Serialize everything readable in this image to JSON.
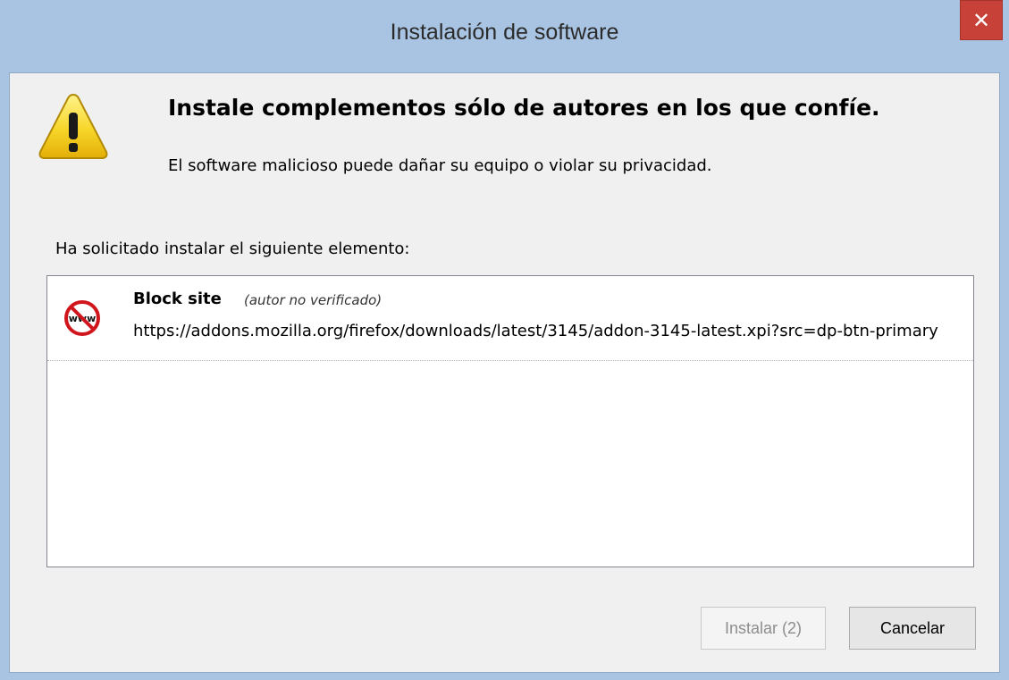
{
  "window": {
    "title": "Instalación de software",
    "close_label": "✕"
  },
  "warning": {
    "icon": "warning-icon",
    "heading": "Instale complementos sólo de autores en los que confíe.",
    "subtext": "El software malicioso puede dañar su equipo o violar su privacidad."
  },
  "request_label": "Ha solicitado instalar el siguiente elemento:",
  "items": [
    {
      "icon": "block-site-icon",
      "name": "Block site",
      "author": "(autor no verificado)",
      "url": "https://addons.mozilla.org/firefox/downloads/latest/3145/addon-3145-latest.xpi?src=dp-btn-primary"
    }
  ],
  "buttons": {
    "install": "Instalar (2)",
    "cancel": "Cancelar"
  },
  "colors": {
    "titlebar": "#a9c4e2",
    "close": "#c74139",
    "dialog_bg": "#f0f0f0"
  }
}
